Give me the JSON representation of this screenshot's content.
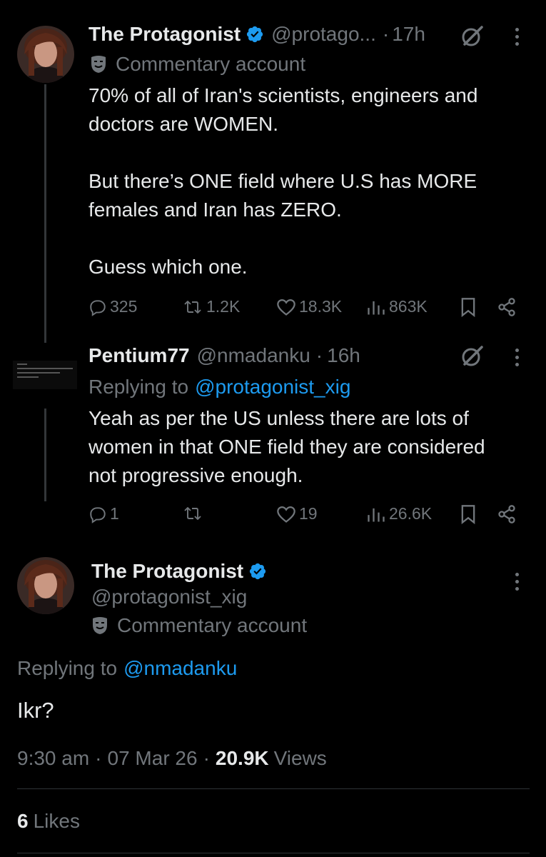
{
  "colors": {
    "background": "#000000",
    "text": "#e7e9ea",
    "muted": "#71767b",
    "link": "#1d9bf0",
    "verified": "#1d9bf0",
    "divider": "#2f3336"
  },
  "tweet1": {
    "avatar_icon": "profile-photo",
    "name": "The Protagonist",
    "handle": "@protago...",
    "separator": "·",
    "time": "17h",
    "label": "Commentary account",
    "lines": [
      "70% of all of Iran's scientists, engineers and",
      "doctors are WOMEN.",
      "",
      "But there’s ONE field where U.S has MORE",
      "females and Iran has ZERO.",
      "",
      "Guess which one."
    ],
    "replies": "325",
    "reposts": "1.2K",
    "likes": "18.3K",
    "views": "863K"
  },
  "tweet2": {
    "name": "Pentium77",
    "handle": "@nmadanku",
    "separator": "·",
    "time": "16h",
    "replying_prefix": "Replying to",
    "replying_handle": "@protagonist_xig",
    "lines": [
      "Yeah as per the US unless there are lots of",
      "women in that ONE field they are considered",
      "not progressive enough."
    ],
    "replies": "1",
    "reposts": "",
    "likes": "19",
    "views": "26.6K"
  },
  "main": {
    "name": "The Protagonist",
    "handle": "@protagonist_xig",
    "label": "Commentary account",
    "replying_prefix": "Replying to",
    "replying_handle": "@nmadanku",
    "text": "Ikr?",
    "time": "9:30 am",
    "date_sep": "·",
    "date": "07 Mar 26",
    "views_sep": "·",
    "views_count": "20.9K",
    "views_label": "Views",
    "likes_count": "6",
    "likes_label": "Likes"
  }
}
